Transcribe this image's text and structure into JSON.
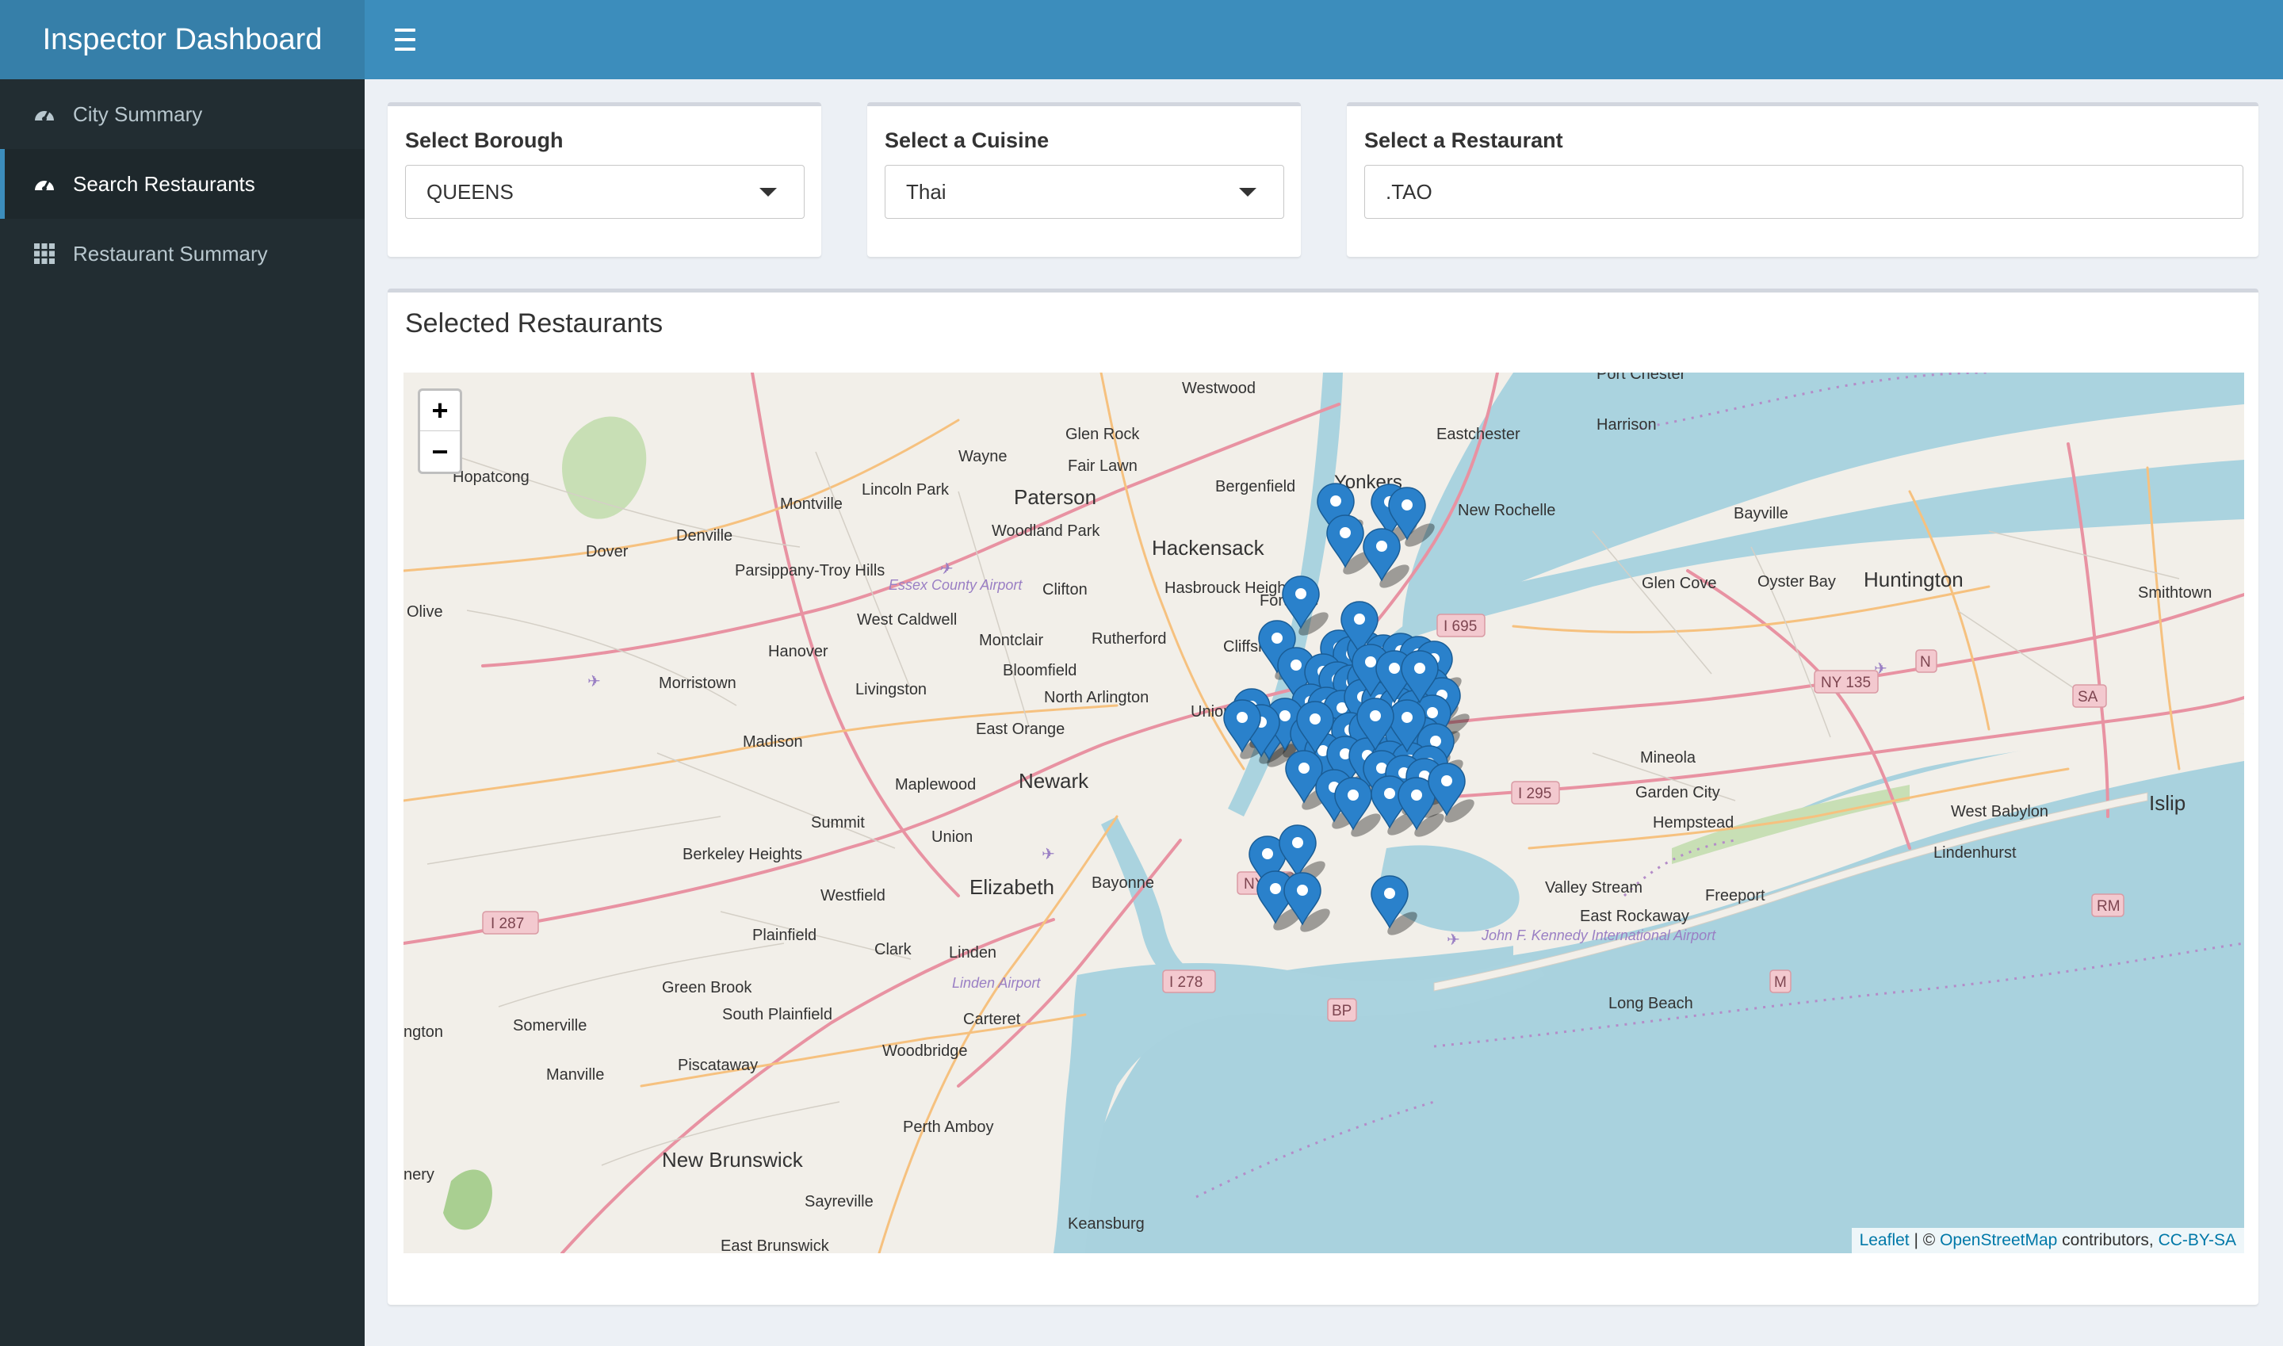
{
  "app": {
    "title": "Inspector Dashboard"
  },
  "sidebar": {
    "items": [
      {
        "label": "City Summary",
        "icon": "dashboard-gauge-icon"
      },
      {
        "label": "Search Restaurants",
        "icon": "dashboard-gauge-icon",
        "active": true
      },
      {
        "label": "Restaurant Summary",
        "icon": "grid-icon"
      }
    ]
  },
  "filters": {
    "borough": {
      "label": "Select Borough",
      "value": "QUEENS"
    },
    "cuisine": {
      "label": "Select a Cuisine",
      "value": "Thai"
    },
    "restaurant": {
      "label": "Select a Restaurant",
      "value": ".TAO"
    }
  },
  "map_panel": {
    "title": "Selected Restaurants",
    "zoom_in": "+",
    "zoom_out": "−",
    "attribution": {
      "leaflet": "Leaflet",
      "separator": " | © ",
      "osm": "OpenStreetMap",
      "contributors": " contributors, ",
      "license": "CC-BY-SA"
    },
    "place_labels": [
      "Westwood",
      "Port Chester",
      "Harrison",
      "Eastchester",
      "Glen Rock",
      "Wayne",
      "Fair Lawn",
      "Bergenfield",
      "Yonkers",
      "Hopatcong",
      "Montville",
      "Lincoln Park",
      "Paterson",
      "New Rochelle",
      "Bayville",
      "Denville",
      "Dover",
      "Parsippany-Troy Hills",
      "Woodland Park",
      "Hackensack",
      "Essex County Airport",
      "Clifton",
      "Hasbrouck Heights",
      "Fort Lee",
      "Glen Cove",
      "Oyster Bay",
      "Huntington",
      "Smithtown",
      "Olive",
      "West Caldwell",
      "Hanover",
      "Montclair",
      "Rutherford",
      "Cliffside",
      "Bloomfield",
      "Morristown",
      "Livingston",
      "North Arlington",
      "Union City",
      "East Orange",
      "Madison",
      "Mineola",
      "Garden City",
      "Hempstead",
      "West Babylon",
      "Islip",
      "Lindenhurst",
      "Maplewood",
      "Newark",
      "Summit",
      "Union",
      "Berkeley Heights",
      "Westfield",
      "Elizabeth",
      "Bayonne",
      "Valley Stream",
      "Freeport",
      "East Rockaway",
      "Plainfield",
      "Clark",
      "Linden",
      "Linden Airport",
      "Carteret",
      "Green Brook",
      "South Plainfield",
      "John F. Kennedy International Airport",
      "Long Beach",
      "ngton",
      "Somerville",
      "Woodbridge",
      "Manville",
      "Piscataway",
      "Perth Amboy",
      "nery",
      "New Brunswick",
      "Sayreville",
      "Keansburg",
      "East Brunswick"
    ],
    "road_shields": [
      "I 695",
      "NY 135",
      "N",
      "SA",
      "I 295",
      "NY 27",
      "I 287",
      "I 278",
      "BP",
      "RM",
      "M"
    ],
    "marker_color": "#2a81cb",
    "land_color": "#f2efe9",
    "water_color": "#aad3df"
  }
}
